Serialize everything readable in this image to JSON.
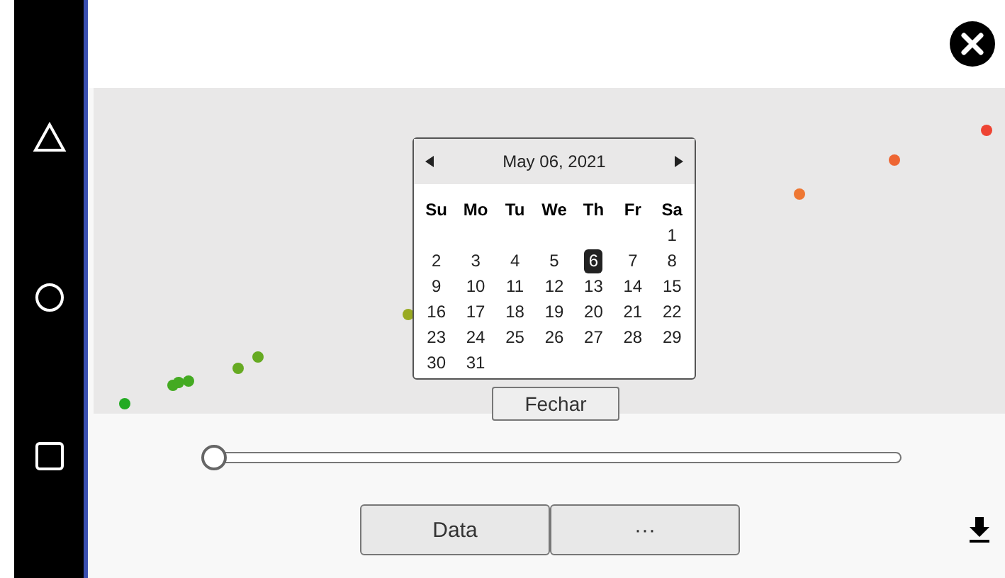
{
  "nav": [
    {
      "kind": "triangle"
    },
    {
      "kind": "circle"
    },
    {
      "kind": "square"
    }
  ],
  "calendar": {
    "title": "May 06, 2021",
    "weekdays": [
      "Su",
      "Mo",
      "Tu",
      "We",
      "Th",
      "Fr",
      "Sa"
    ],
    "weeks": [
      {
        "kind": "end",
        "days": [
          {
            "label": "1",
            "selected": false
          }
        ]
      },
      {
        "kind": "full",
        "days": [
          {
            "label": "2",
            "selected": false
          },
          {
            "label": "3",
            "selected": false
          },
          {
            "label": "4",
            "selected": false
          },
          {
            "label": "5",
            "selected": false
          },
          {
            "label": "6",
            "selected": true
          },
          {
            "label": "7",
            "selected": false
          },
          {
            "label": "8",
            "selected": false
          }
        ]
      },
      {
        "kind": "full",
        "days": [
          {
            "label": "9",
            "selected": false
          },
          {
            "label": "10",
            "selected": false
          },
          {
            "label": "11",
            "selected": false
          },
          {
            "label": "12",
            "selected": false
          },
          {
            "label": "13",
            "selected": false
          },
          {
            "label": "14",
            "selected": false
          },
          {
            "label": "15",
            "selected": false
          }
        ]
      },
      {
        "kind": "full",
        "days": [
          {
            "label": "16",
            "selected": false
          },
          {
            "label": "17",
            "selected": false
          },
          {
            "label": "18",
            "selected": false
          },
          {
            "label": "19",
            "selected": false
          },
          {
            "label": "20",
            "selected": false
          },
          {
            "label": "21",
            "selected": false
          },
          {
            "label": "22",
            "selected": false
          }
        ]
      },
      {
        "kind": "full",
        "days": [
          {
            "label": "23",
            "selected": false
          },
          {
            "label": "24",
            "selected": false
          },
          {
            "label": "25",
            "selected": false
          },
          {
            "label": "26",
            "selected": false
          },
          {
            "label": "27",
            "selected": false
          },
          {
            "label": "28",
            "selected": false
          },
          {
            "label": "29",
            "selected": false
          }
        ]
      },
      {
        "kind": "start",
        "days": [
          {
            "label": "30",
            "selected": false
          },
          {
            "label": "31",
            "selected": false
          }
        ]
      }
    ],
    "close_label": "Fechar"
  },
  "slider": {
    "level": 0
  },
  "buttons": [
    "Data",
    "···"
  ]
}
